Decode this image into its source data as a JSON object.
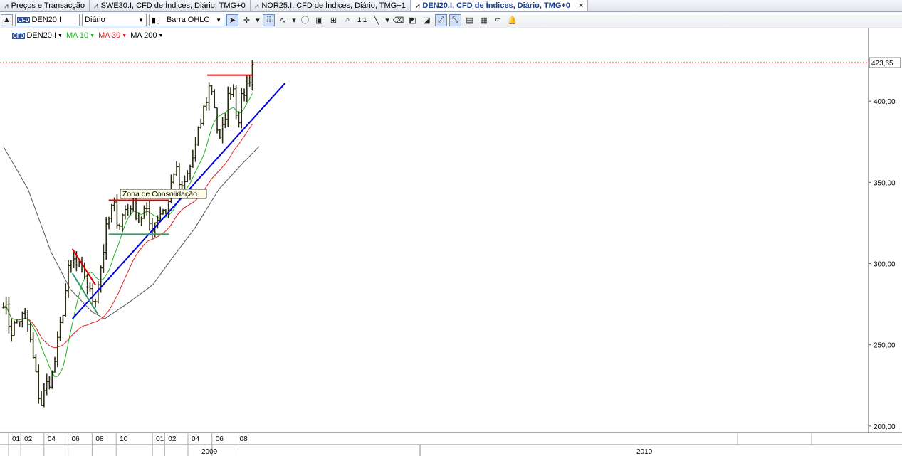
{
  "tabs": [
    {
      "label": "Preços e Transacção",
      "icon": "chart-icon",
      "active": false
    },
    {
      "label": "SWE30.I, CFD de Índices, Diário, TMG+0",
      "icon": "chart-icon",
      "active": false
    },
    {
      "label": "NOR25.I, CFD de Índices, Diário, TMG+1",
      "icon": "chart-icon",
      "active": false
    },
    {
      "label": "DEN20.I, CFD de Índices, Diário, TMG+0",
      "icon": "chart-icon",
      "active": true
    }
  ],
  "close_glyph": "×",
  "toolbar": {
    "symbol": "DEN20.I",
    "symbol_logo": "CFD",
    "period": "Diário",
    "chart_type": "Barra OHLC",
    "zoom_reset": "1:1"
  },
  "legend": {
    "symbol": "DEN20.I",
    "ma_fast": {
      "label": "MA 10",
      "color": "#22b022"
    },
    "ma_mid": {
      "label": "MA 30",
      "color": "#e02020"
    },
    "ma_slow": {
      "label": "MA 200",
      "color": "#000000"
    }
  },
  "colors": {
    "bars": "#2b2b10",
    "ma10": "#22b022",
    "ma30": "#e02020",
    "ma200": "#555555",
    "trendline": "#0000dd",
    "resistance": "#e00000",
    "support": "#339966",
    "price_line": "#cc0000"
  },
  "chart_data": {
    "type": "ohlc",
    "instrument": "DEN20.I",
    "period": "Diário",
    "last_price": 423.65,
    "ylim": [
      195,
      436
    ],
    "y_ticks": [
      "200,00",
      "250,00",
      "300,00",
      "350,00",
      "400,00"
    ],
    "y_tick_values": [
      200,
      250,
      300,
      350,
      400
    ],
    "last_price_label": "423,65",
    "x_months": [
      {
        "label": "01",
        "date": "2009-01"
      },
      {
        "label": "02",
        "date": "2009-02"
      },
      {
        "label": "04",
        "date": "2009-04"
      },
      {
        "label": "06",
        "date": "2009-06"
      },
      {
        "label": "08",
        "date": "2009-08"
      },
      {
        "label": "10",
        "date": "2009-10"
      },
      {
        "label": "01",
        "date": "2010-01"
      },
      {
        "label": "02",
        "date": "2010-02"
      },
      {
        "label": "04",
        "date": "2010-04"
      },
      {
        "label": "06",
        "date": "2010-06"
      },
      {
        "label": "08",
        "date": "2010-08"
      }
    ],
    "x_years": [
      "2009",
      "2010"
    ],
    "price_path": [
      [
        "2008-12-01",
        278
      ],
      [
        "2008-12-20",
        258
      ],
      [
        "2009-01-10",
        266
      ],
      [
        "2009-01-28",
        268
      ],
      [
        "2009-02-15",
        240
      ],
      [
        "2009-03-05",
        212
      ],
      [
        "2009-03-20",
        225
      ],
      [
        "2009-04-05",
        232
      ],
      [
        "2009-04-25",
        262
      ],
      [
        "2009-05-15",
        295
      ],
      [
        "2009-05-25",
        303
      ],
      [
        "2009-06-05",
        298
      ],
      [
        "2009-06-25",
        293
      ],
      [
        "2009-07-10",
        280
      ],
      [
        "2009-07-20",
        277
      ],
      [
        "2009-08-05",
        298
      ],
      [
        "2009-08-20",
        322
      ],
      [
        "2009-09-05",
        337
      ],
      [
        "2009-09-20",
        324
      ],
      [
        "2009-10-05",
        333
      ],
      [
        "2009-10-25",
        338
      ],
      [
        "2009-11-10",
        327
      ],
      [
        "2009-11-25",
        333
      ],
      [
        "2009-12-10",
        322
      ],
      [
        "2009-12-25",
        328
      ],
      [
        "2010-01-08",
        334
      ],
      [
        "2010-01-20",
        332
      ],
      [
        "2010-02-05",
        358
      ],
      [
        "2010-02-15",
        355
      ],
      [
        "2010-02-25",
        343
      ],
      [
        "2010-03-10",
        352
      ],
      [
        "2010-03-30",
        368
      ],
      [
        "2010-04-20",
        392
      ],
      [
        "2010-05-10",
        412
      ],
      [
        "2010-05-20",
        398
      ],
      [
        "2010-06-01",
        373
      ],
      [
        "2010-06-10",
        382
      ],
      [
        "2010-06-20",
        398
      ],
      [
        "2010-07-05",
        413
      ],
      [
        "2010-07-18",
        387
      ],
      [
        "2010-08-01",
        405
      ],
      [
        "2010-08-15",
        412
      ],
      [
        "2010-08-25",
        424
      ]
    ],
    "ma200_path": [
      [
        "2008-12-01",
        372
      ],
      [
        "2009-02-01",
        346
      ],
      [
        "2009-04-01",
        307
      ],
      [
        "2009-05-20",
        284
      ],
      [
        "2009-07-15",
        270
      ],
      [
        "2009-08-15",
        266
      ],
      [
        "2009-10-15",
        276
      ],
      [
        "2009-12-15",
        287
      ],
      [
        "2010-02-01",
        303
      ],
      [
        "2010-04-01",
        322
      ],
      [
        "2010-06-01",
        346
      ],
      [
        "2010-08-01",
        362
      ],
      [
        "2010-09-10",
        372
      ]
    ],
    "drawings": {
      "trendline": {
        "from": [
          "2009-05-25",
          266
        ],
        "to": [
          "2010-11-15",
          411
        ]
      },
      "resistance_zone": {
        "from": "2009-08-25",
        "to": "2010-01-25",
        "value": 339
      },
      "support_zone": {
        "from": "2009-08-25",
        "to": "2010-01-25",
        "value": 318
      },
      "resistance_2010": {
        "from": "2010-05-02",
        "to": "2010-08-25",
        "value": 416
      },
      "downtrend_upper": {
        "from": [
          "2009-05-25",
          309
        ],
        "to": [
          "2009-07-22",
          287
        ]
      },
      "downtrend_lower": {
        "from": [
          "2009-05-25",
          294
        ],
        "to": [
          "2009-07-28",
          269
        ]
      },
      "annotation": {
        "text": "Zona de Consolidação",
        "at": [
          "2009-09-25",
          341
        ]
      }
    }
  }
}
